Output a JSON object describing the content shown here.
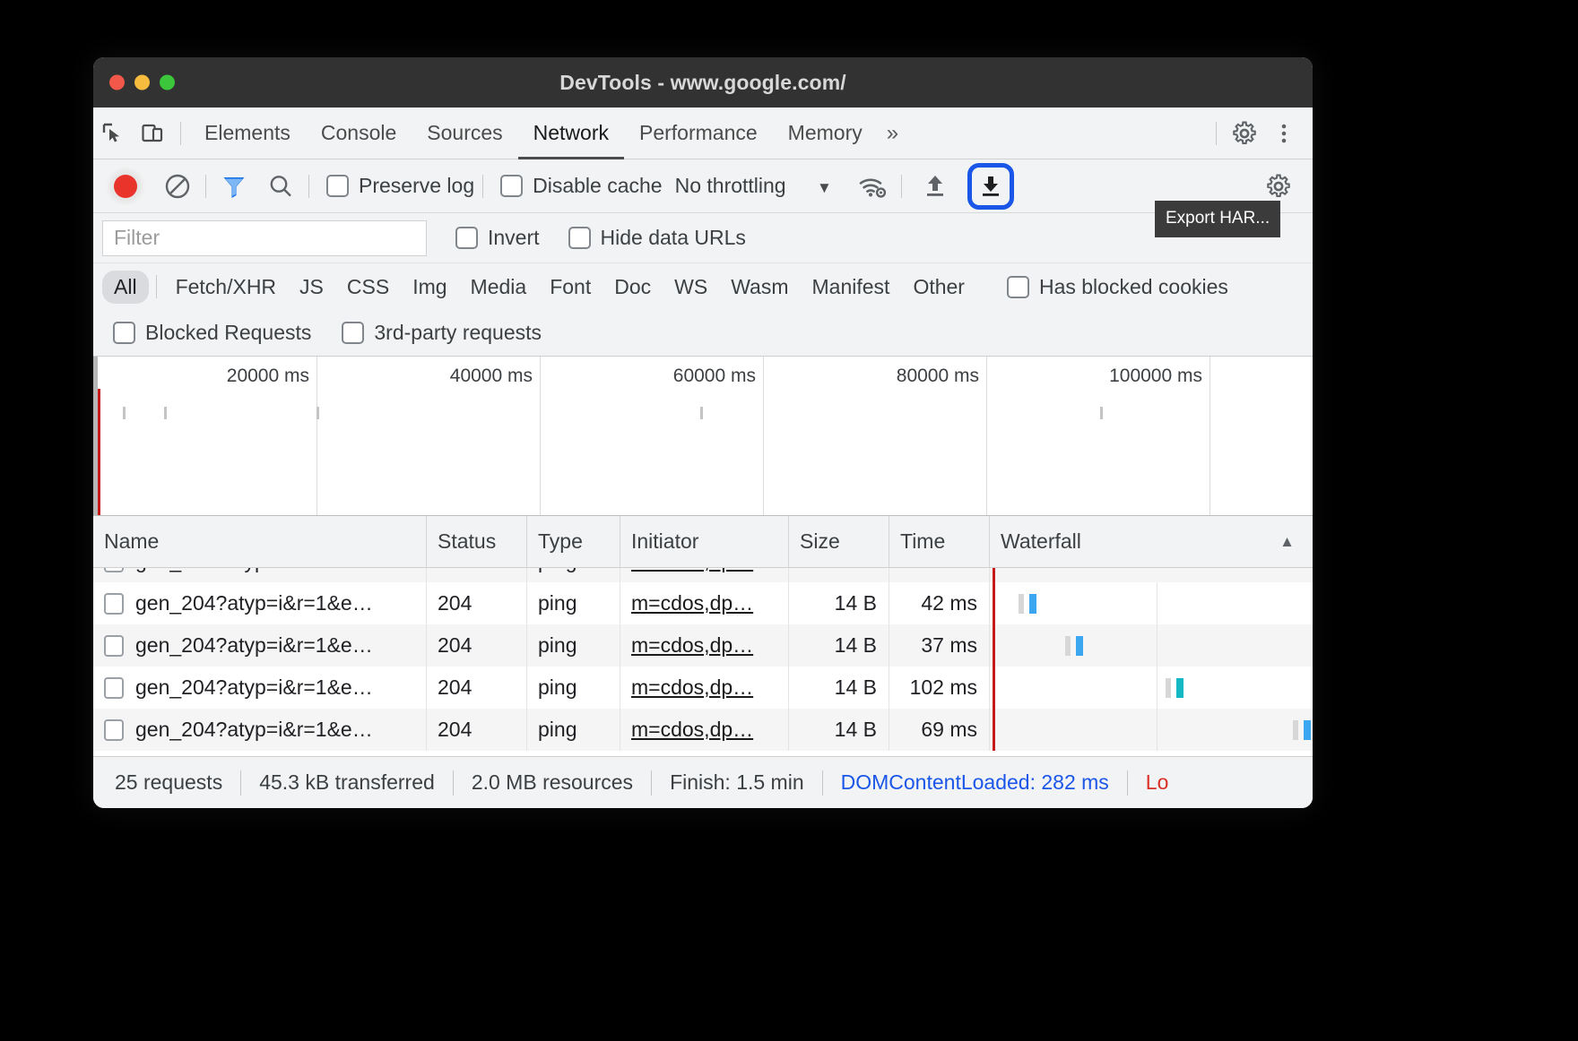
{
  "window": {
    "title": "DevTools - www.google.com/",
    "traffic_lights": [
      "close",
      "minimize",
      "maximize"
    ]
  },
  "main_tabs": {
    "items": [
      {
        "label": "Elements",
        "active": false
      },
      {
        "label": "Console",
        "active": false
      },
      {
        "label": "Sources",
        "active": false
      },
      {
        "label": "Network",
        "active": true
      },
      {
        "label": "Performance",
        "active": false
      },
      {
        "label": "Memory",
        "active": false
      }
    ],
    "more_label": "»",
    "icons": [
      "inspect-icon",
      "device-toolbar-icon",
      "settings-gear-icon",
      "more-vertical-icon"
    ]
  },
  "network_toolbar": {
    "record_title": "record-button",
    "clear_title": "clear-button",
    "filter_title": "filter-button",
    "search_title": "search-button",
    "preserve_log_label": "Preserve log",
    "preserve_log_checked": false,
    "disable_cache_label": "Disable cache",
    "disable_cache_checked": false,
    "throttling_value": "No throttling",
    "throttling_caret": "▼",
    "import_har_title": "import-har-button",
    "export_har_title": "export-har-button",
    "settings_title": "network-settings-button",
    "tooltip": "Export HAR..."
  },
  "filter_bar": {
    "filter_placeholder": "Filter",
    "filter_value": "",
    "invert_label": "Invert",
    "invert_checked": false,
    "hide_data_urls_label": "Hide data URLs",
    "hide_data_urls_checked": false
  },
  "type_filters": {
    "items": [
      {
        "label": "All",
        "selected": true
      },
      {
        "label": "Fetch/XHR",
        "selected": false
      },
      {
        "label": "JS",
        "selected": false
      },
      {
        "label": "CSS",
        "selected": false
      },
      {
        "label": "Img",
        "selected": false
      },
      {
        "label": "Media",
        "selected": false
      },
      {
        "label": "Font",
        "selected": false
      },
      {
        "label": "Doc",
        "selected": false
      },
      {
        "label": "WS",
        "selected": false
      },
      {
        "label": "Wasm",
        "selected": false
      },
      {
        "label": "Manifest",
        "selected": false
      },
      {
        "label": "Other",
        "selected": false
      }
    ],
    "has_blocked_cookies_label": "Has blocked cookies",
    "has_blocked_cookies_checked": false,
    "blocked_requests_label": "Blocked Requests",
    "blocked_requests_checked": false,
    "third_party_label": "3rd-party requests",
    "third_party_checked": false
  },
  "overview": {
    "ticks": [
      "20000 ms",
      "40000 ms",
      "60000 ms",
      "80000 ms",
      "100000 ms"
    ]
  },
  "table": {
    "columns": [
      "Name",
      "Status",
      "Type",
      "Initiator",
      "Size",
      "Time",
      "Waterfall"
    ],
    "sort_indicator": "▲",
    "rows": [
      {
        "name": "gen_204?atyp=i&r=1&e…",
        "status": "204",
        "type": "ping",
        "initiator": "m=cdos,dp…",
        "size": "14 B",
        "time": "42 ms",
        "wf_left_pct": 9,
        "wf_color": "blue"
      },
      {
        "name": "gen_204?atyp=i&r=1&e…",
        "status": "204",
        "type": "ping",
        "initiator": "m=cdos,dp…",
        "size": "14 B",
        "time": "37 ms",
        "wf_left_pct": 24,
        "wf_color": "blue"
      },
      {
        "name": "gen_204?atyp=i&r=1&e…",
        "status": "204",
        "type": "ping",
        "initiator": "m=cdos,dp…",
        "size": "14 B",
        "time": "102 ms",
        "wf_left_pct": 58,
        "wf_color": "teal"
      },
      {
        "name": "gen_204?atyp=i&r=1&e…",
        "status": "204",
        "type": "ping",
        "initiator": "m=cdos,dp…",
        "size": "14 B",
        "time": "69 ms",
        "wf_left_pct": 99,
        "wf_color": "blue"
      }
    ]
  },
  "status_bar": {
    "requests": "25 requests",
    "transferred": "45.3 kB transferred",
    "resources": "2.0 MB resources",
    "finish": "Finish: 1.5 min",
    "dom_content_loaded": "DOMContentLoaded: 282 ms",
    "load": "Lo"
  },
  "colors": {
    "accent_blue": "#1a56e8",
    "record_red": "#e8342a",
    "waterfall_blue": "#3ba7f0",
    "waterfall_teal": "#14b8c4",
    "dcl_red": "#c71b1b",
    "link_blue": "#1a56e8",
    "load_red": "#d93025"
  }
}
